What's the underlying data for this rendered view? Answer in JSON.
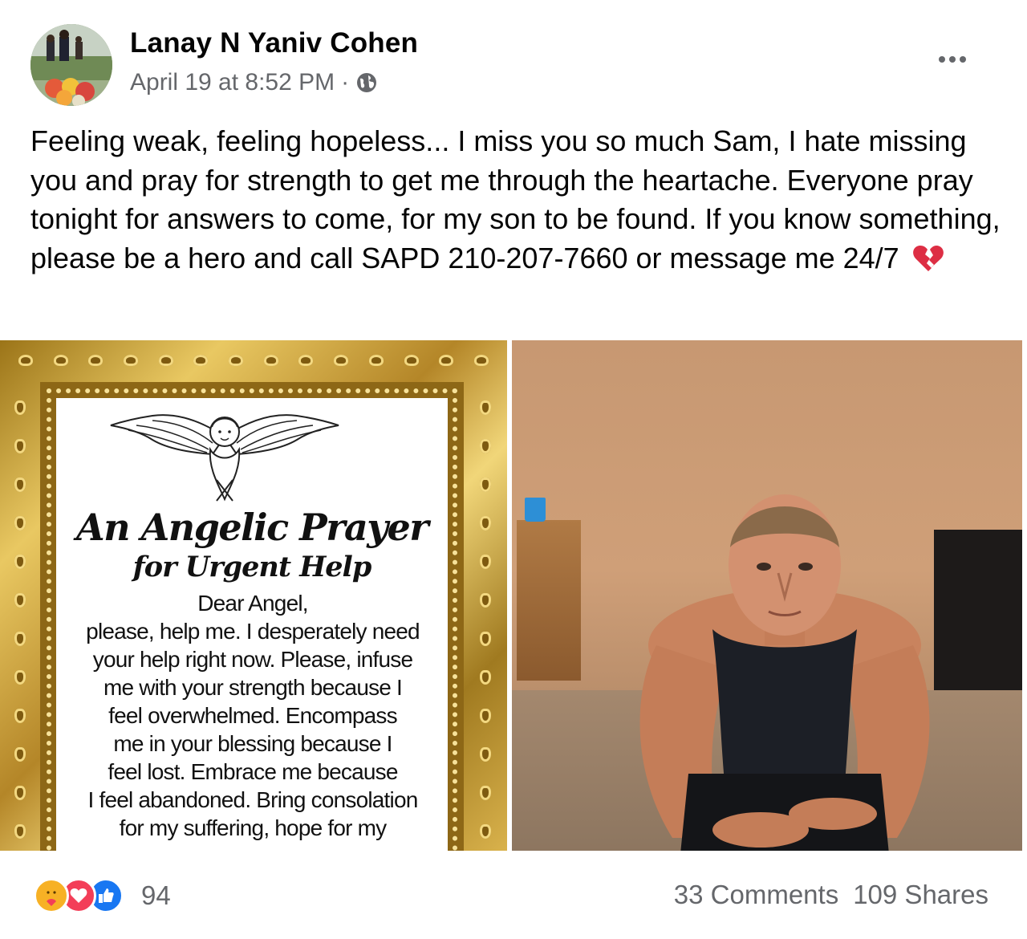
{
  "post": {
    "author": "Lanay N Yaniv Cohen",
    "timestamp": "April 19 at 8:52 PM",
    "separator": "·",
    "privacy_icon": "globe-icon",
    "more_icon": "more-options-icon",
    "message": "Feeling weak, feeling hopeless... I miss you so much Sam, I hate missing you and pray for strength to get me through the heartache. Everyone pray tonight for answers to come, for my son to be found. If you know something, please be a hero and call SAPD 210-207-7660 or message me 24/7",
    "message_emoji": "broken-heart-icon"
  },
  "photos": {
    "prayer": {
      "title": "An Angelic Prayer",
      "subtitle": "for Urgent Help",
      "lines": [
        "Dear Angel,",
        "please, help me. I desperately need",
        "your help right now. Please, infuse",
        "me with your strength because I",
        "feel overwhelmed. Encompass",
        "me in your blessing because I",
        "feel lost. Embrace me because",
        "I feel abandoned. Bring consolation",
        "for my suffering, hope for my"
      ]
    }
  },
  "footer": {
    "reaction_icons": [
      "care-icon",
      "love-icon",
      "like-icon"
    ],
    "reaction_count": "94",
    "comments": "33 Comments",
    "shares": "109 Shares"
  },
  "colors": {
    "secondary_text": "#65676b",
    "like_blue": "#1877f2",
    "love_red": "#f33e58",
    "care_yellow": "#f7b125"
  }
}
